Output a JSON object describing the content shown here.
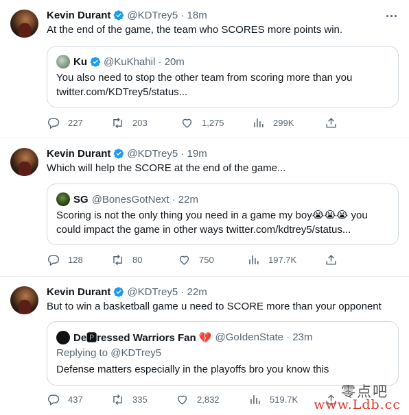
{
  "tweets": [
    {
      "name": "Kevin Durant",
      "handle": "@KDTrey5 · 18m",
      "text": "At the end of the game, the team who SCORES more points win.",
      "quote": {
        "name": "Ku",
        "handle": "@KuKhahil · 20m",
        "line1": "You also need to stop the other team from scoring more than you",
        "line2": "twitter.com/KDTrey5/status..."
      },
      "replies": "227",
      "retweets": "203",
      "likes": "1,275",
      "views": "299K"
    },
    {
      "name": "Kevin Durant",
      "handle": "@KDTrey5 · 19m",
      "text": "Which will help the SCORE at the end of the game...",
      "quote": {
        "name": "SG",
        "handle": "@BonesGotNext · 22m",
        "line1": "Scoring is not the only thing you need in a game my boy😭😭😭 you",
        "line2": "could impact the game in other ways twitter.com/kdtrey5/status..."
      },
      "replies": "128",
      "retweets": "80",
      "likes": "750",
      "views": "197.7K"
    },
    {
      "name": "Kevin Durant",
      "handle": "@KDTrey5 · 22m",
      "text": "But to win a basketball game u need to SCORE more than your opponent",
      "quote": {
        "name": "De🅿ressed Warriors Fan 💔",
        "handle": "@GoIdenState · 23m",
        "reply_to": "Replying to @KDTrey5",
        "line1": "Defense matters especially in the playoffs bro you know this"
      },
      "replies": "437",
      "retweets": "335",
      "likes": "2,832",
      "views": "519.7K"
    }
  ],
  "watermark": {
    "line1": "零点吧",
    "line2": "www.Ldb.cc"
  },
  "colors": {
    "verified": "#1d9bf0",
    "secondary_text": "#536471",
    "border": "#cfd9de"
  }
}
